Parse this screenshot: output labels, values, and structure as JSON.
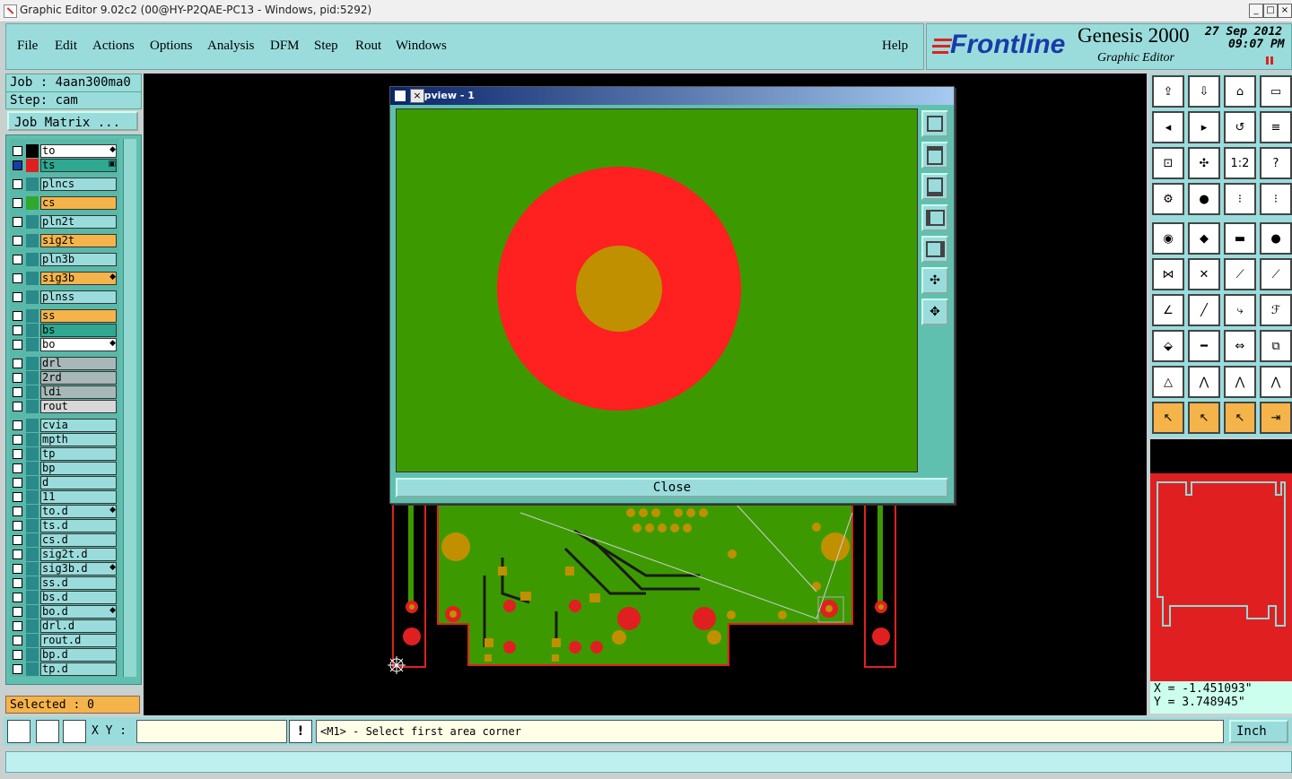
{
  "window": {
    "title": "Graphic Editor 9.02c2 (00@HY-P2QAE-PC13 - Windows, pid:5292)",
    "min_label": "_",
    "max_label": "□",
    "close_label": "×"
  },
  "menu": {
    "items": [
      "File",
      "Edit",
      "Actions",
      "Options",
      "Analysis",
      "DFM",
      "Step",
      "Rout",
      "Windows"
    ],
    "help": "Help"
  },
  "brand": {
    "logo_text": "Frontline",
    "product": "Genesis 2000",
    "subtitle": "Graphic Editor",
    "date": "27 Sep 2012",
    "time": "09:07 PM"
  },
  "job": {
    "job_line": "Job : 4aan300ma0",
    "step_line": "Step: cam",
    "matrix_label": "Job Matrix ..."
  },
  "layers": [
    {
      "name": "to",
      "color": "#ffffff",
      "swatch": "#000000",
      "mark": "◆"
    },
    {
      "name": "ts",
      "color": "#2ea890",
      "swatch": "#e02020",
      "mark": "▣",
      "active": true
    },
    {
      "name": "plncs",
      "color": "#9adcdc",
      "swatch": "#2a8a8a"
    },
    {
      "name": "cs",
      "color": "#f5b44a",
      "swatch": "#2ea82e"
    },
    {
      "name": "pln2t",
      "color": "#9adcdc",
      "swatch": "#2a8a8a"
    },
    {
      "name": "sig2t",
      "color": "#f5b44a",
      "swatch": "#2a8a8a"
    },
    {
      "name": "pln3b",
      "color": "#9adcdc",
      "swatch": "#2a8a8a"
    },
    {
      "name": "sig3b",
      "color": "#f5b44a",
      "swatch": "#2a8a8a",
      "mark": "◆"
    },
    {
      "name": "plnss",
      "color": "#9adcdc",
      "swatch": "#2a8a8a"
    },
    {
      "name": "ss",
      "color": "#f5b44a",
      "swatch": "#2a8a8a"
    },
    {
      "name": "bs",
      "color": "#2ea890",
      "swatch": "#2a8a8a"
    },
    {
      "name": "bo",
      "color": "#ffffff",
      "swatch": "#2a8a8a",
      "mark": "◆"
    },
    {
      "name": "drl",
      "color": "#a8b8b8",
      "swatch": "#2a8a8a"
    },
    {
      "name": "2rd",
      "color": "#a8b8b8",
      "swatch": "#2a8a8a"
    },
    {
      "name": "ldi",
      "color": "#a8b8b8",
      "swatch": "#2a8a8a"
    },
    {
      "name": "rout",
      "color": "#d8d8d8",
      "swatch": "#2a8a8a"
    },
    {
      "name": "cvia",
      "color": "#9adcdc",
      "swatch": "#2a8a8a"
    },
    {
      "name": "mpth",
      "color": "#9adcdc",
      "swatch": "#2a8a8a"
    },
    {
      "name": "tp",
      "color": "#9adcdc",
      "swatch": "#2a8a8a"
    },
    {
      "name": "bp",
      "color": "#9adcdc",
      "swatch": "#2a8a8a"
    },
    {
      "name": "d",
      "color": "#9adcdc",
      "swatch": "#2a8a8a"
    },
    {
      "name": "11",
      "color": "#9adcdc",
      "swatch": "#2a8a8a"
    },
    {
      "name": "to.d",
      "color": "#9adcdc",
      "swatch": "#2a8a8a",
      "mark": "◆"
    },
    {
      "name": "ts.d",
      "color": "#9adcdc",
      "swatch": "#2a8a8a"
    },
    {
      "name": "cs.d",
      "color": "#9adcdc",
      "swatch": "#2a8a8a"
    },
    {
      "name": "sig2t.d",
      "color": "#9adcdc",
      "swatch": "#2a8a8a"
    },
    {
      "name": "sig3b.d",
      "color": "#9adcdc",
      "swatch": "#2a8a8a",
      "mark": "◆"
    },
    {
      "name": "ss.d",
      "color": "#9adcdc",
      "swatch": "#2a8a8a"
    },
    {
      "name": "bs.d",
      "color": "#9adcdc",
      "swatch": "#2a8a8a"
    },
    {
      "name": "bo.d",
      "color": "#9adcdc",
      "swatch": "#2a8a8a",
      "mark": "◆"
    },
    {
      "name": "drl.d",
      "color": "#9adcdc",
      "swatch": "#2a8a8a"
    },
    {
      "name": "rout.d",
      "color": "#9adcdc",
      "swatch": "#2a8a8a"
    },
    {
      "name": "bp.d",
      "color": "#9adcdc",
      "swatch": "#2a8a8a"
    },
    {
      "name": "tp.d",
      "color": "#9adcdc",
      "swatch": "#2a8a8a"
    }
  ],
  "selected": "Selected : 0",
  "popup": {
    "title": "Popview - 1",
    "close_label": "Close"
  },
  "coords": {
    "x": "X = -1.451093\"",
    "y": "Y = 3.748945\""
  },
  "bottom": {
    "xy_label": "X Y :",
    "xy_value": "",
    "prompt": "<M1> - Select first area corner",
    "unit": "Inch"
  },
  "colors": {
    "panel": "#9adcdc",
    "board": "#3c9a00",
    "pad": "#c09000",
    "copper_red": "#ff2020",
    "canvas": "#000000"
  }
}
